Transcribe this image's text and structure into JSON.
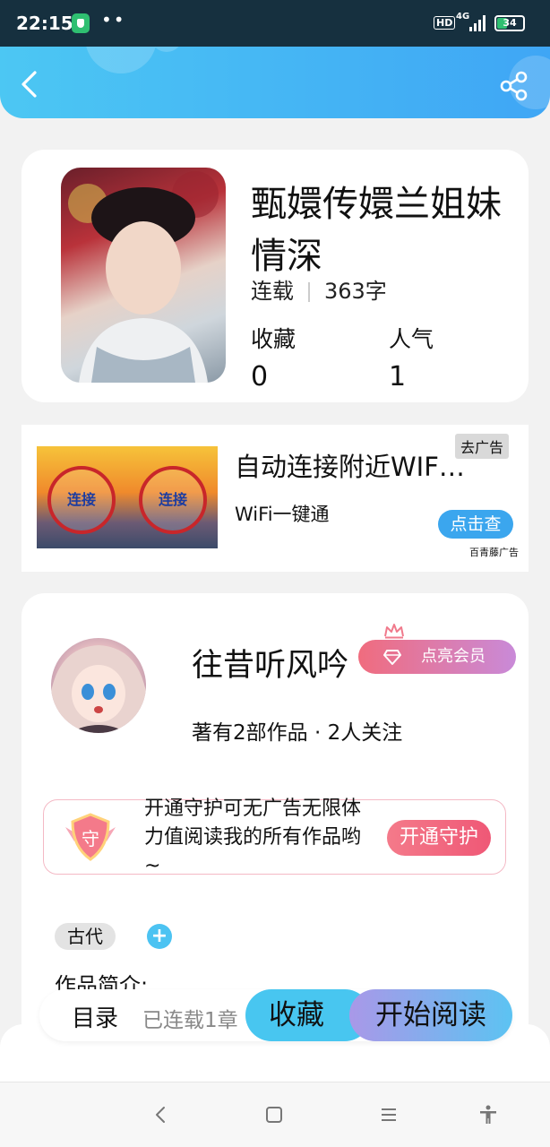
{
  "status_bar": {
    "time": "22:15",
    "dots": "••",
    "hd": "HD",
    "network": "4G",
    "battery": "34"
  },
  "book": {
    "title": "甄嬛传嬛兰姐妹情深",
    "status": "连载",
    "word_count": "363字",
    "favorites_label": "收藏",
    "popularity_label": "人气",
    "favorites_value": "0",
    "popularity_value": "1"
  },
  "ad": {
    "title": "自动连接附近WIF…",
    "subtitle": "WiFi一键通",
    "close_label": "去广告",
    "cta_label": "点击查",
    "source": "百青藤广告",
    "stamp_text": "连接"
  },
  "author": {
    "name": "往昔听风吟",
    "vip_label": "点亮会员",
    "meta": "著有2部作品 · 2人关注",
    "guard_badge": "守",
    "guard_text": "开通守护可无广告无限体力值阅读我的所有作品哟~",
    "guard_button": "开通守护",
    "tag": "古代",
    "tag_add": "+",
    "intro_label": "作品简介:"
  },
  "action_bar": {
    "toc_label": "目录",
    "toc_status": "已连载1章",
    "favorite_label": "收藏",
    "read_label": "开始阅读"
  },
  "colors": {
    "header_gradient": [
      "#4cc7f3",
      "#3fa6f5"
    ],
    "accent": "#48c6f0",
    "vip": "#f06c7e"
  },
  "icons": [
    "back-icon",
    "share-icon",
    "crown-icon",
    "gem-icon",
    "shield-icon",
    "plus-icon"
  ]
}
